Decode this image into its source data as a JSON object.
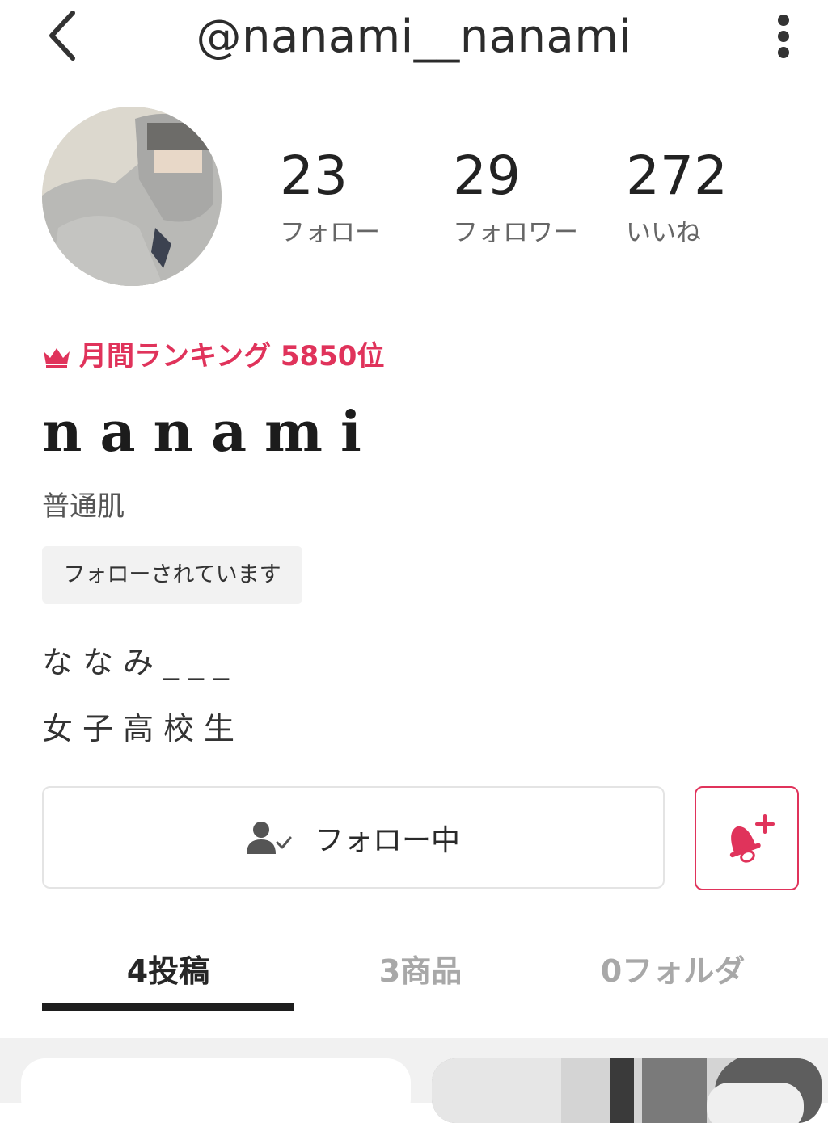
{
  "header": {
    "title": "@nanami__nanami",
    "back_icon": "chevron-left-icon",
    "more_icon": "vertical-ellipsis-icon"
  },
  "profile": {
    "stats": [
      {
        "value": "23",
        "label": "フォロー"
      },
      {
        "value": "29",
        "label": "フォロワー"
      },
      {
        "value": "272",
        "label": "いいね"
      }
    ],
    "ranking": "月間ランキング 5850位",
    "display_name": "nanami",
    "skin_type": "普通肌",
    "follows_you_badge": "フォローされています",
    "bio_lines": [
      "ななみ___",
      "女子高校生"
    ]
  },
  "actions": {
    "follow_label": "フォロー中",
    "follow_icon": "user-check-icon",
    "notify_icon": "bell-plus-icon"
  },
  "tabs": [
    {
      "label": "4投稿",
      "active": true
    },
    {
      "label": "3商品",
      "active": false
    },
    {
      "label": "0フォルダ",
      "active": false
    }
  ],
  "colors": {
    "accent": "#e0335b",
    "text_primary": "#222222",
    "text_secondary": "#666666",
    "tab_inactive": "#a8a8a8"
  }
}
